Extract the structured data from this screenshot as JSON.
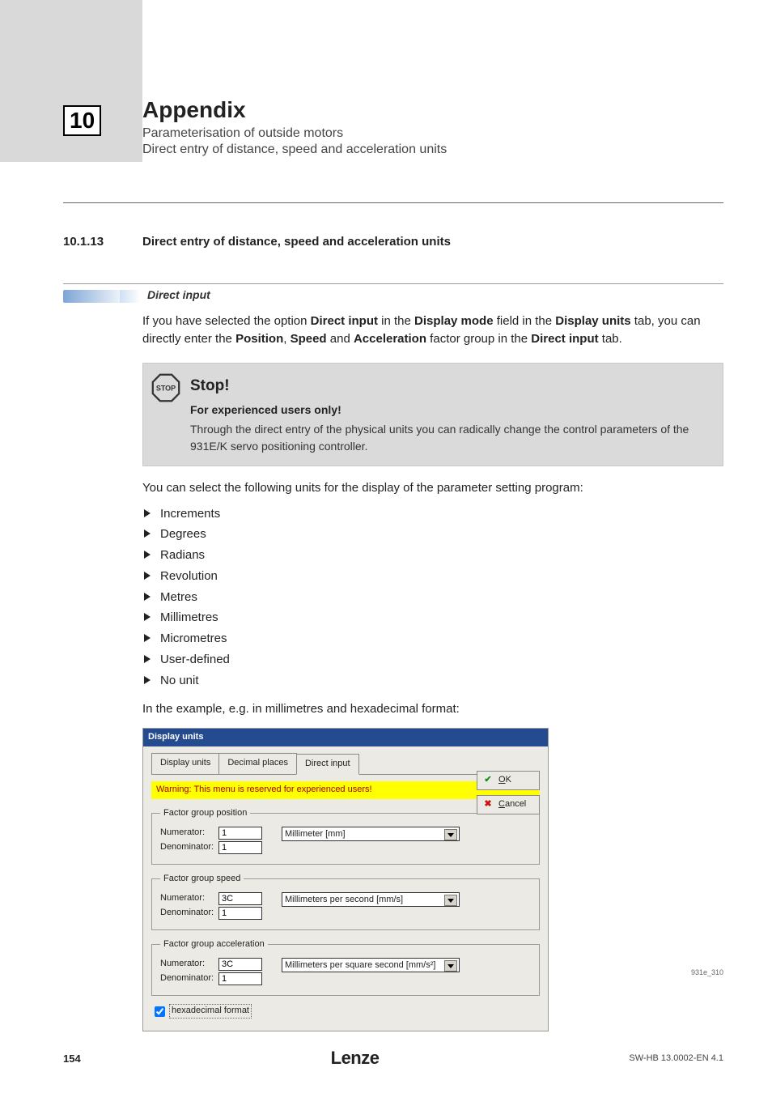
{
  "chapter_number": "10",
  "header": {
    "title": "Appendix",
    "sub1": "Parameterisation of outside motors",
    "sub2": "Direct entry of distance, speed and acceleration units"
  },
  "section": {
    "number": "10.1.13",
    "title": "Direct entry of distance, speed and acceleration units"
  },
  "direct_input_label": "Direct input",
  "intro_html": "If you have selected the option <b>Direct input</b> in the <b>Display mode</b> field in the <b>Display units</b> tab, you can directly enter the <b>Position</b>, <b>Speed</b> and <b>Acceleration</b> factor group in the <b>Direct input</b> tab.",
  "stop": {
    "title": "Stop!",
    "subtitle": "For experienced users only!",
    "text": "Through the direct entry of the physical units you can radically change the control parameters of the 931E/K servo positioning controller."
  },
  "para_after_stop": "You can select the following units for the display of the parameter setting program:",
  "units": [
    "Increments",
    "Degrees",
    "Radians",
    "Revolution",
    "Metres",
    "Millimetres",
    "Micrometres",
    "User-defined",
    "No unit"
  ],
  "example_line": "In the example, e.g. in millimetres and hexadecimal format:",
  "dialog": {
    "title": "Display units",
    "tabs": [
      "Display units",
      "Decimal places",
      "Direct input"
    ],
    "active_tab": 2,
    "warning": "Warning: This menu is reserved for experienced users!",
    "groups": {
      "position": {
        "legend": "Factor group position",
        "numerator_label": "Numerator:",
        "numerator": "1",
        "denominator_label": "Denominator:",
        "denominator": "1",
        "unit": "Millimeter [mm]"
      },
      "speed": {
        "legend": "Factor group speed",
        "numerator_label": "Numerator:",
        "numerator": "3C",
        "denominator_label": "Denominator:",
        "denominator": "1",
        "unit": "Millimeters per second [mm/s]"
      },
      "acceleration": {
        "legend": "Factor group acceleration",
        "numerator_label": "Numerator:",
        "numerator": "3C",
        "denominator_label": "Denominator:",
        "denominator": "1",
        "unit": "Millimeters per square second [mm/s²]"
      }
    },
    "hex_label": "hexadecimal format",
    "ok": "OK",
    "cancel": "Cancel"
  },
  "figure_ref": "931e_310",
  "footer": {
    "page": "154",
    "brand": "Lenze",
    "doc": "SW-HB 13.0002-EN   4.1"
  }
}
